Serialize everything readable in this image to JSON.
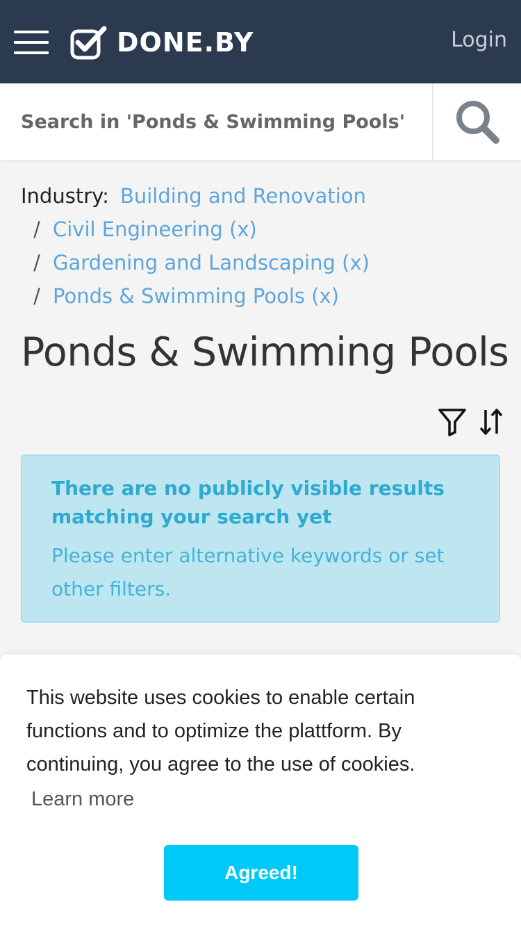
{
  "header": {
    "brand": "DONE.BY",
    "login_label": "Login",
    "background_color": "#2b3a4f"
  },
  "search": {
    "placeholder": "Search in 'Ponds & Swimming Pools'",
    "icon": "search-icon"
  },
  "breadcrumb": {
    "label": "Industry:",
    "separator": "/",
    "items": [
      {
        "label": "Building and Renovation"
      },
      {
        "label": "Civil Engineering (x)"
      },
      {
        "label": "Gardening and Landscaping (x)"
      },
      {
        "label": "Ponds & Swimming Pools (x)"
      }
    ],
    "link_color": "#5fa5dc"
  },
  "page": {
    "title": "Ponds & Swimming Pools"
  },
  "toolbar": {
    "filter_icon": "filter-icon",
    "sort_icon": "sort-icon"
  },
  "alert": {
    "title": "There are no publicly visible results matching your search yet",
    "body": "Please enter alternative keywords or set other filters.",
    "background_color": "#bee6f1",
    "text_color": "#2ea9cf"
  },
  "cookie_banner": {
    "text": "This website uses cookies to enable certain functions and to optimize the plattform. By continuing, you agree to the use of cookies.",
    "learn_more": "Learn more",
    "button_label": "Agreed!",
    "button_color": "#00c8f8"
  }
}
